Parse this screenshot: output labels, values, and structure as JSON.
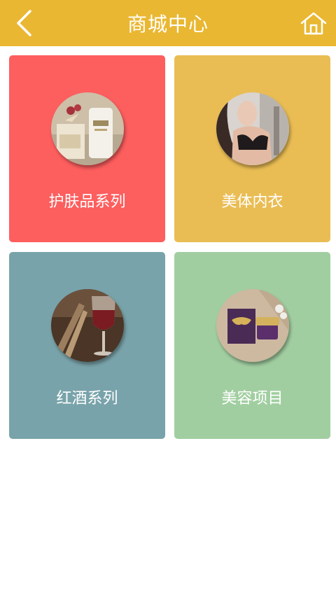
{
  "header": {
    "title": "商城中心",
    "back_icon": "chevron-left-icon",
    "home_icon": "home-icon",
    "background": "#E9B731"
  },
  "categories": [
    {
      "label": "护肤品系列",
      "color": "#FD5E5E",
      "image": "skincare-product-photo"
    },
    {
      "label": "美体内衣",
      "color": "#EABD54",
      "image": "lingerie-model-photo"
    },
    {
      "label": "红酒系列",
      "color": "#79A3AA",
      "image": "red-wine-glass-photo"
    },
    {
      "label": "美容项目",
      "color": "#A1CEA1",
      "image": "beauty-cream-box-photo"
    }
  ]
}
